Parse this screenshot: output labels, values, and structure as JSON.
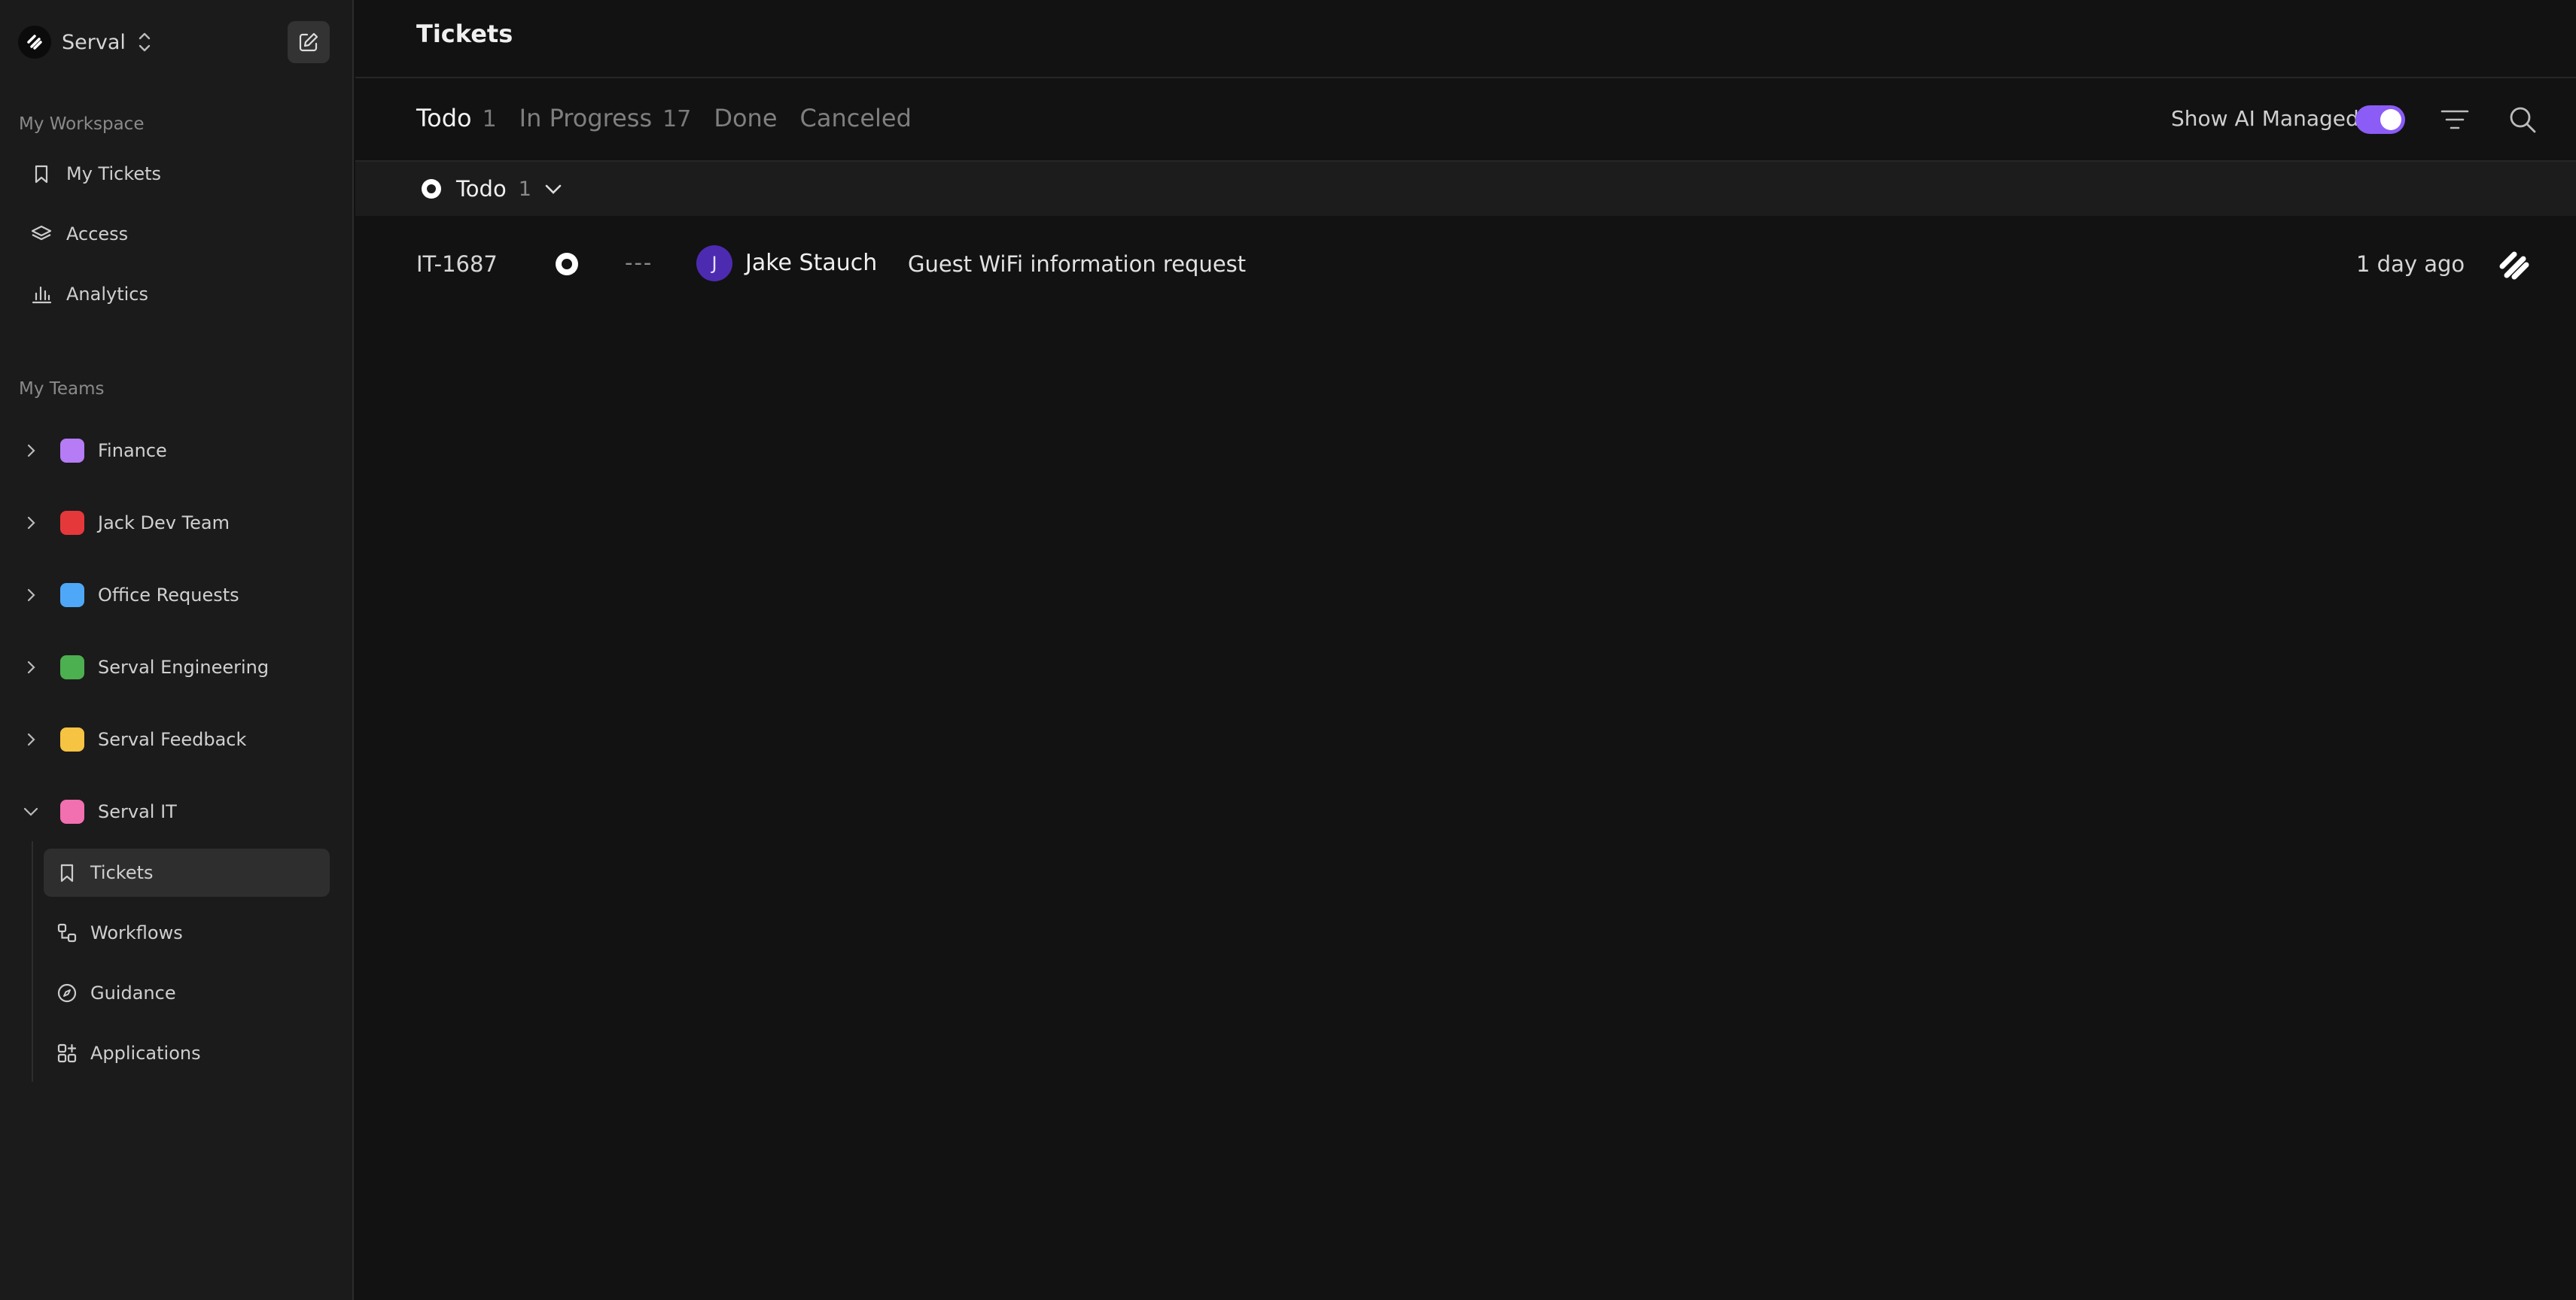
{
  "workspace": {
    "name": "Serval"
  },
  "sidebar": {
    "my_workspace_label": "My Workspace",
    "workspace_items": [
      {
        "label": "My Tickets",
        "icon": "bookmark-icon"
      },
      {
        "label": "Access",
        "icon": "layers-icon"
      },
      {
        "label": "Analytics",
        "icon": "bar-chart-icon"
      }
    ],
    "my_teams_label": "My Teams",
    "teams": [
      {
        "label": "Finance",
        "color": "#b57cf6",
        "expanded": false
      },
      {
        "label": "Jack Dev Team",
        "color": "#e5383b",
        "expanded": false
      },
      {
        "label": "Office Requests",
        "color": "#4fa8f7",
        "expanded": false
      },
      {
        "label": "Serval Engineering",
        "color": "#4caf50",
        "expanded": false
      },
      {
        "label": "Serval Feedback",
        "color": "#f6c342",
        "expanded": false
      },
      {
        "label": "Serval IT",
        "color": "#f26fb0",
        "expanded": true
      }
    ],
    "team_sub_items": [
      {
        "label": "Tickets",
        "icon": "bookmark-icon",
        "active": true
      },
      {
        "label": "Workflows",
        "icon": "workflow-icon",
        "active": false
      },
      {
        "label": "Guidance",
        "icon": "compass-icon",
        "active": false
      },
      {
        "label": "Applications",
        "icon": "apps-icon",
        "active": false
      }
    ]
  },
  "main": {
    "title": "Tickets",
    "tabs": [
      {
        "label": "Todo",
        "count": "1",
        "active": true
      },
      {
        "label": "In Progress",
        "count": "17",
        "active": false
      },
      {
        "label": "Done",
        "count": "",
        "active": false
      },
      {
        "label": "Canceled",
        "count": "",
        "active": false
      }
    ],
    "ai_toggle": {
      "label": "Show AI Managed",
      "on": true,
      "color": "#8b5cf6"
    },
    "group": {
      "label": "Todo",
      "count": "1"
    },
    "tickets": [
      {
        "id": "IT-1687",
        "priority": "---",
        "assignee_initial": "J",
        "assignee": "Jake Stauch",
        "title": "Guest WiFi information request",
        "time": "1 day ago"
      }
    ]
  }
}
